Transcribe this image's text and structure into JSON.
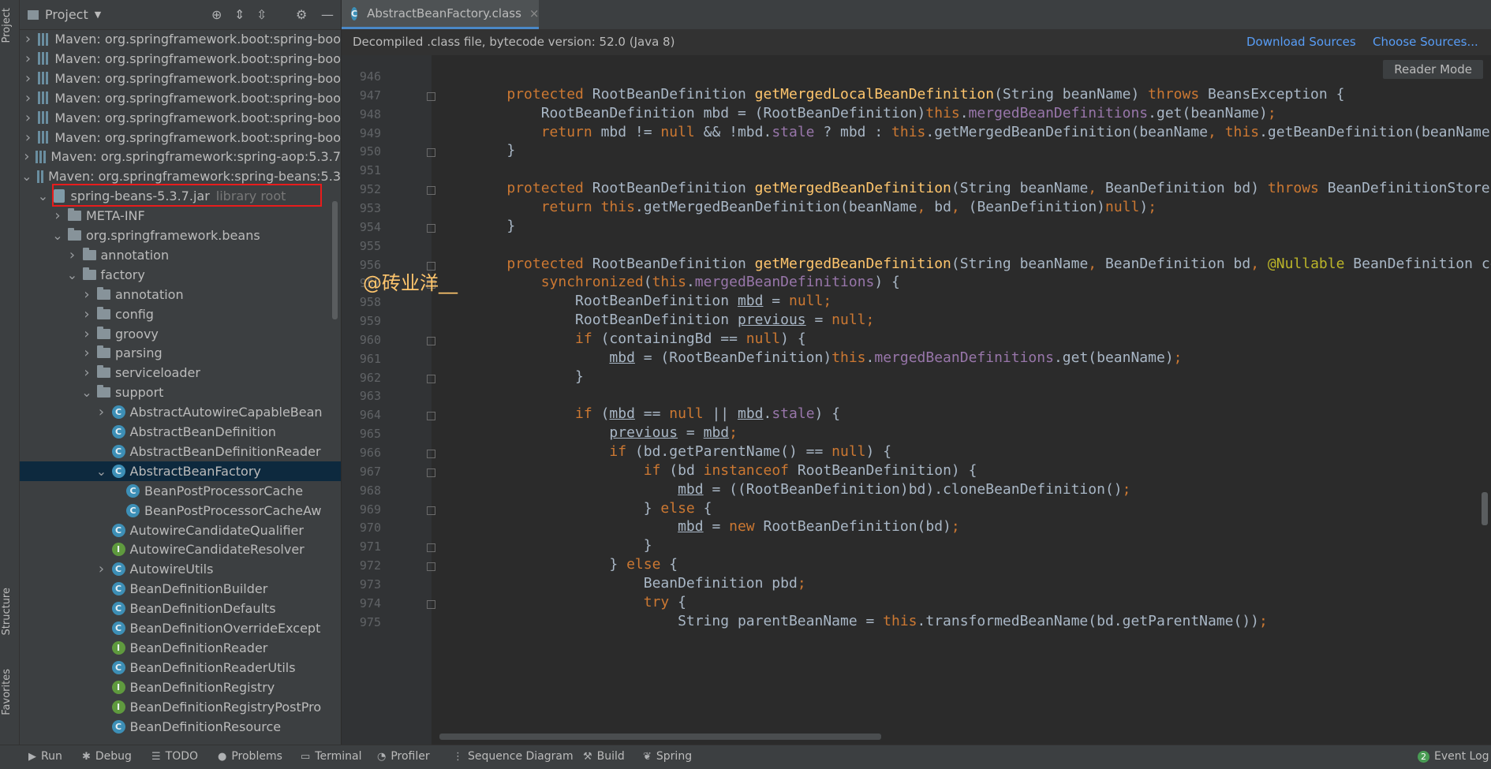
{
  "stripe": {
    "project": "Project",
    "structure": "Structure",
    "favorites": "Favorites"
  },
  "project_panel": {
    "title": "Project",
    "tree": [
      {
        "label": "Maven: org.springframework.boot:spring-boo",
        "kind": "lib",
        "depth": 1,
        "chev": "collapsed"
      },
      {
        "label": "Maven: org.springframework.boot:spring-boo",
        "kind": "lib",
        "depth": 1,
        "chev": "collapsed"
      },
      {
        "label": "Maven: org.springframework.boot:spring-boo",
        "kind": "lib",
        "depth": 1,
        "chev": "collapsed"
      },
      {
        "label": "Maven: org.springframework.boot:spring-boo",
        "kind": "lib",
        "depth": 1,
        "chev": "collapsed"
      },
      {
        "label": "Maven: org.springframework.boot:spring-boo",
        "kind": "lib",
        "depth": 1,
        "chev": "collapsed"
      },
      {
        "label": "Maven: org.springframework.boot:spring-boo",
        "kind": "lib",
        "depth": 1,
        "chev": "collapsed"
      },
      {
        "label": "Maven: org.springframework:spring-aop:5.3.7",
        "kind": "lib",
        "depth": 1,
        "chev": "collapsed"
      },
      {
        "label": "Maven: org.springframework:spring-beans:5.3",
        "kind": "lib",
        "depth": 1,
        "chev": "expanded"
      },
      {
        "label": "spring-beans-5.3.7.jar",
        "suffix": "library root",
        "kind": "jar",
        "depth": 2,
        "chev": "expanded"
      },
      {
        "label": "META-INF",
        "kind": "folder",
        "depth": 3,
        "chev": "collapsed"
      },
      {
        "label": "org.springframework.beans",
        "kind": "folder",
        "depth": 3,
        "chev": "expanded"
      },
      {
        "label": "annotation",
        "kind": "folder",
        "depth": 4,
        "chev": "collapsed"
      },
      {
        "label": "factory",
        "kind": "folder",
        "depth": 4,
        "chev": "expanded"
      },
      {
        "label": "annotation",
        "kind": "folder",
        "depth": 5,
        "chev": "collapsed"
      },
      {
        "label": "config",
        "kind": "folder",
        "depth": 5,
        "chev": "collapsed"
      },
      {
        "label": "groovy",
        "kind": "folder",
        "depth": 5,
        "chev": "collapsed"
      },
      {
        "label": "parsing",
        "kind": "folder",
        "depth": 5,
        "chev": "collapsed"
      },
      {
        "label": "serviceloader",
        "kind": "folder",
        "depth": 5,
        "chev": "collapsed"
      },
      {
        "label": "support",
        "kind": "folder",
        "depth": 5,
        "chev": "expanded"
      },
      {
        "label": "AbstractAutowireCapableBean",
        "kind": "class",
        "depth": 6,
        "chev": "collapsed"
      },
      {
        "label": "AbstractBeanDefinition",
        "kind": "class",
        "depth": 6,
        "chev": "none"
      },
      {
        "label": "AbstractBeanDefinitionReader",
        "kind": "class",
        "depth": 6,
        "chev": "none"
      },
      {
        "label": "AbstractBeanFactory",
        "kind": "class",
        "depth": 6,
        "chev": "expanded",
        "selected": true
      },
      {
        "label": "BeanPostProcessorCache",
        "kind": "class",
        "depth": 7,
        "chev": "none"
      },
      {
        "label": "BeanPostProcessorCacheAw",
        "kind": "class",
        "depth": 7,
        "chev": "none"
      },
      {
        "label": "AutowireCandidateQualifier",
        "kind": "class",
        "depth": 6,
        "chev": "none"
      },
      {
        "label": "AutowireCandidateResolver",
        "kind": "interface",
        "depth": 6,
        "chev": "none"
      },
      {
        "label": "AutowireUtils",
        "kind": "class",
        "depth": 6,
        "chev": "collapsed"
      },
      {
        "label": "BeanDefinitionBuilder",
        "kind": "class",
        "depth": 6,
        "chev": "none"
      },
      {
        "label": "BeanDefinitionDefaults",
        "kind": "class",
        "depth": 6,
        "chev": "none"
      },
      {
        "label": "BeanDefinitionOverrideExcept",
        "kind": "class",
        "depth": 6,
        "chev": "none"
      },
      {
        "label": "BeanDefinitionReader",
        "kind": "interface",
        "depth": 6,
        "chev": "none"
      },
      {
        "label": "BeanDefinitionReaderUtils",
        "kind": "class",
        "depth": 6,
        "chev": "none"
      },
      {
        "label": "BeanDefinitionRegistry",
        "kind": "interface",
        "depth": 6,
        "chev": "none"
      },
      {
        "label": "BeanDefinitionRegistryPostPro",
        "kind": "interface",
        "depth": 6,
        "chev": "none"
      },
      {
        "label": "BeanDefinitionResource",
        "kind": "class",
        "depth": 6,
        "chev": "none"
      }
    ]
  },
  "editor": {
    "tab_label": "AbstractBeanFactory.class",
    "tab_close": "×",
    "banner_text": "Decompiled .class file, bytecode version: 52.0 (Java 8)",
    "download_sources": "Download Sources",
    "choose_sources": "Choose Sources...",
    "reader_mode": "Reader Mode",
    "watermark": "@砖业洋__",
    "lines": [
      {
        "n": "946",
        "fold": false,
        "tokens": []
      },
      {
        "n": "947",
        "fold": true,
        "tokens": [
          [
            "    ",
            ""
          ],
          [
            "protected ",
            "kw"
          ],
          [
            "RootBeanDefinition ",
            ""
          ],
          [
            "getMergedLocalBeanDefinition",
            "fn"
          ],
          [
            "(String beanName) ",
            ""
          ],
          [
            "throws ",
            "kw"
          ],
          [
            "BeansException {",
            ""
          ]
        ]
      },
      {
        "n": "948",
        "fold": false,
        "tokens": [
          [
            "        RootBeanDefinition mbd = (RootBeanDefinition)",
            ""
          ],
          [
            "this",
            "kw"
          ],
          [
            ".",
            ""
          ],
          [
            "mergedBeanDefinitions",
            "fld"
          ],
          [
            ".get(beanName)",
            ""
          ],
          [
            ";",
            "kw"
          ]
        ]
      },
      {
        "n": "949",
        "fold": false,
        "tokens": [
          [
            "        ",
            ""
          ],
          [
            "return ",
            "kw"
          ],
          [
            "mbd != ",
            ""
          ],
          [
            "null ",
            "kw"
          ],
          [
            "&& !mbd.",
            ""
          ],
          [
            "stale",
            "fld"
          ],
          [
            " ? mbd : ",
            ""
          ],
          [
            "this",
            "kw"
          ],
          [
            ".getMergedBeanDefinition(beanName",
            ""
          ],
          [
            ", ",
            "kw"
          ],
          [
            "this",
            "kw"
          ],
          [
            ".getBeanDefinition(beanName))",
            ""
          ]
        ]
      },
      {
        "n": "950",
        "fold": true,
        "tokens": [
          [
            "    }",
            ""
          ]
        ]
      },
      {
        "n": "951",
        "fold": false,
        "tokens": []
      },
      {
        "n": "952",
        "fold": true,
        "tokens": [
          [
            "    ",
            ""
          ],
          [
            "protected ",
            "kw"
          ],
          [
            "RootBeanDefinition ",
            ""
          ],
          [
            "getMergedBeanDefinition",
            "fn"
          ],
          [
            "(String beanName",
            ""
          ],
          [
            ", ",
            "kw"
          ],
          [
            "BeanDefinition bd) ",
            ""
          ],
          [
            "throws ",
            "kw"
          ],
          [
            "BeanDefinitionStoreExc",
            ""
          ]
        ]
      },
      {
        "n": "953",
        "fold": false,
        "tokens": [
          [
            "        ",
            ""
          ],
          [
            "return ",
            "kw"
          ],
          [
            "this",
            "kw"
          ],
          [
            ".getMergedBeanDefinition(beanName",
            ""
          ],
          [
            ", ",
            "kw"
          ],
          [
            "bd",
            ""
          ],
          [
            ", ",
            "kw"
          ],
          [
            "(BeanDefinition)",
            ""
          ],
          [
            "null",
            "kw"
          ],
          [
            ")",
            ""
          ],
          [
            ";",
            "kw"
          ]
        ]
      },
      {
        "n": "954",
        "fold": true,
        "tokens": [
          [
            "    }",
            ""
          ]
        ]
      },
      {
        "n": "955",
        "fold": false,
        "tokens": []
      },
      {
        "n": "956",
        "fold": true,
        "tokens": [
          [
            "    ",
            ""
          ],
          [
            "protected ",
            "kw"
          ],
          [
            "RootBeanDefinition ",
            ""
          ],
          [
            "getMergedBeanDefinition",
            "fn"
          ],
          [
            "(String beanName",
            ""
          ],
          [
            ", ",
            "kw"
          ],
          [
            "BeanDefinition bd",
            ""
          ],
          [
            ", ",
            "kw"
          ],
          [
            "@Nullable ",
            "ann"
          ],
          [
            "BeanDefinition cont",
            ""
          ]
        ]
      },
      {
        "n": "957",
        "fold": true,
        "tokens": [
          [
            "        ",
            ""
          ],
          [
            "synchronized",
            "kw"
          ],
          [
            "(",
            ""
          ],
          [
            "this",
            "kw"
          ],
          [
            ".",
            ""
          ],
          [
            "mergedBeanDefinitions",
            "fld"
          ],
          [
            ") {",
            ""
          ]
        ]
      },
      {
        "n": "958",
        "fold": false,
        "tokens": [
          [
            "            RootBeanDefinition ",
            ""
          ],
          [
            "mbd",
            "ul"
          ],
          [
            " = ",
            ""
          ],
          [
            "null",
            "kw"
          ],
          [
            ";",
            "kw"
          ]
        ]
      },
      {
        "n": "959",
        "fold": false,
        "tokens": [
          [
            "            RootBeanDefinition ",
            ""
          ],
          [
            "previous",
            "ul"
          ],
          [
            " = ",
            ""
          ],
          [
            "null",
            "kw"
          ],
          [
            ";",
            "kw"
          ]
        ]
      },
      {
        "n": "960",
        "fold": true,
        "tokens": [
          [
            "            ",
            ""
          ],
          [
            "if ",
            "kw"
          ],
          [
            "(containingBd == ",
            ""
          ],
          [
            "null",
            "kw"
          ],
          [
            ") {",
            ""
          ]
        ]
      },
      {
        "n": "961",
        "fold": false,
        "tokens": [
          [
            "                ",
            ""
          ],
          [
            "mbd",
            "ul"
          ],
          [
            " = (RootBeanDefinition)",
            ""
          ],
          [
            "this",
            "kw"
          ],
          [
            ".",
            ""
          ],
          [
            "mergedBeanDefinitions",
            "fld"
          ],
          [
            ".get(beanName)",
            ""
          ],
          [
            ";",
            "kw"
          ]
        ]
      },
      {
        "n": "962",
        "fold": true,
        "tokens": [
          [
            "            }",
            ""
          ]
        ]
      },
      {
        "n": "963",
        "fold": false,
        "tokens": []
      },
      {
        "n": "964",
        "fold": true,
        "tokens": [
          [
            "            ",
            ""
          ],
          [
            "if ",
            "kw"
          ],
          [
            "(",
            ""
          ],
          [
            "mbd",
            "ul"
          ],
          [
            " == ",
            ""
          ],
          [
            "null ",
            "kw"
          ],
          [
            "|| ",
            ""
          ],
          [
            "mbd",
            "ul"
          ],
          [
            ".",
            ""
          ],
          [
            "stale",
            "fld"
          ],
          [
            ") {",
            ""
          ]
        ]
      },
      {
        "n": "965",
        "fold": false,
        "tokens": [
          [
            "                ",
            ""
          ],
          [
            "previous",
            "ul"
          ],
          [
            " = ",
            ""
          ],
          [
            "mbd",
            "ul"
          ],
          [
            ";",
            "kw"
          ]
        ]
      },
      {
        "n": "966",
        "fold": true,
        "tokens": [
          [
            "                ",
            ""
          ],
          [
            "if ",
            "kw"
          ],
          [
            "(bd.getParentName() == ",
            ""
          ],
          [
            "null",
            "kw"
          ],
          [
            ") {",
            ""
          ]
        ]
      },
      {
        "n": "967",
        "fold": true,
        "tokens": [
          [
            "                    ",
            ""
          ],
          [
            "if ",
            "kw"
          ],
          [
            "(bd ",
            ""
          ],
          [
            "instanceof ",
            "kw"
          ],
          [
            "RootBeanDefinition) {",
            ""
          ]
        ]
      },
      {
        "n": "968",
        "fold": false,
        "tokens": [
          [
            "                        ",
            ""
          ],
          [
            "mbd",
            "ul"
          ],
          [
            " = ((RootBeanDefinition)bd).cloneBeanDefinition()",
            ""
          ],
          [
            ";",
            "kw"
          ]
        ]
      },
      {
        "n": "969",
        "fold": true,
        "tokens": [
          [
            "                    } ",
            ""
          ],
          [
            "else ",
            "kw"
          ],
          [
            "{",
            ""
          ]
        ]
      },
      {
        "n": "970",
        "fold": false,
        "tokens": [
          [
            "                        ",
            ""
          ],
          [
            "mbd",
            "ul"
          ],
          [
            " = ",
            ""
          ],
          [
            "new ",
            "kw"
          ],
          [
            "RootBeanDefinition(bd)",
            ""
          ],
          [
            ";",
            "kw"
          ]
        ]
      },
      {
        "n": "971",
        "fold": true,
        "tokens": [
          [
            "                    }",
            ""
          ]
        ]
      },
      {
        "n": "972",
        "fold": true,
        "tokens": [
          [
            "                } ",
            ""
          ],
          [
            "else ",
            "kw"
          ],
          [
            "{",
            ""
          ]
        ]
      },
      {
        "n": "973",
        "fold": false,
        "tokens": [
          [
            "                    BeanDefinition pbd",
            ""
          ],
          [
            ";",
            "kw"
          ]
        ]
      },
      {
        "n": "974",
        "fold": true,
        "tokens": [
          [
            "                    ",
            ""
          ],
          [
            "try ",
            "kw"
          ],
          [
            "{",
            ""
          ]
        ]
      },
      {
        "n": "975",
        "fold": false,
        "tokens": [
          [
            "                        String parentBeanName = ",
            ""
          ],
          [
            "this",
            "kw"
          ],
          [
            ".transformedBeanName(bd.getParentName())",
            ""
          ],
          [
            ";",
            "kw"
          ]
        ]
      }
    ]
  },
  "bottom_bar": [
    {
      "label": "Run",
      "icon": "▶",
      "name": "run"
    },
    {
      "label": "Debug",
      "icon": "✱",
      "name": "debug"
    },
    {
      "label": "TODO",
      "icon": "☰",
      "name": "todo"
    },
    {
      "label": "Problems",
      "icon": "●",
      "name": "problems"
    },
    {
      "label": "Terminal",
      "icon": "▭",
      "name": "terminal"
    },
    {
      "label": "Profiler",
      "icon": "◔",
      "name": "profiler"
    },
    {
      "label": "Sequence Diagram",
      "icon": "⋮",
      "name": "sequence-diagram"
    },
    {
      "label": "Build",
      "icon": "⚒",
      "name": "build"
    },
    {
      "label": "Spring",
      "icon": "❦",
      "name": "spring"
    }
  ],
  "event_log": {
    "label": "Event Log",
    "count": "2"
  }
}
